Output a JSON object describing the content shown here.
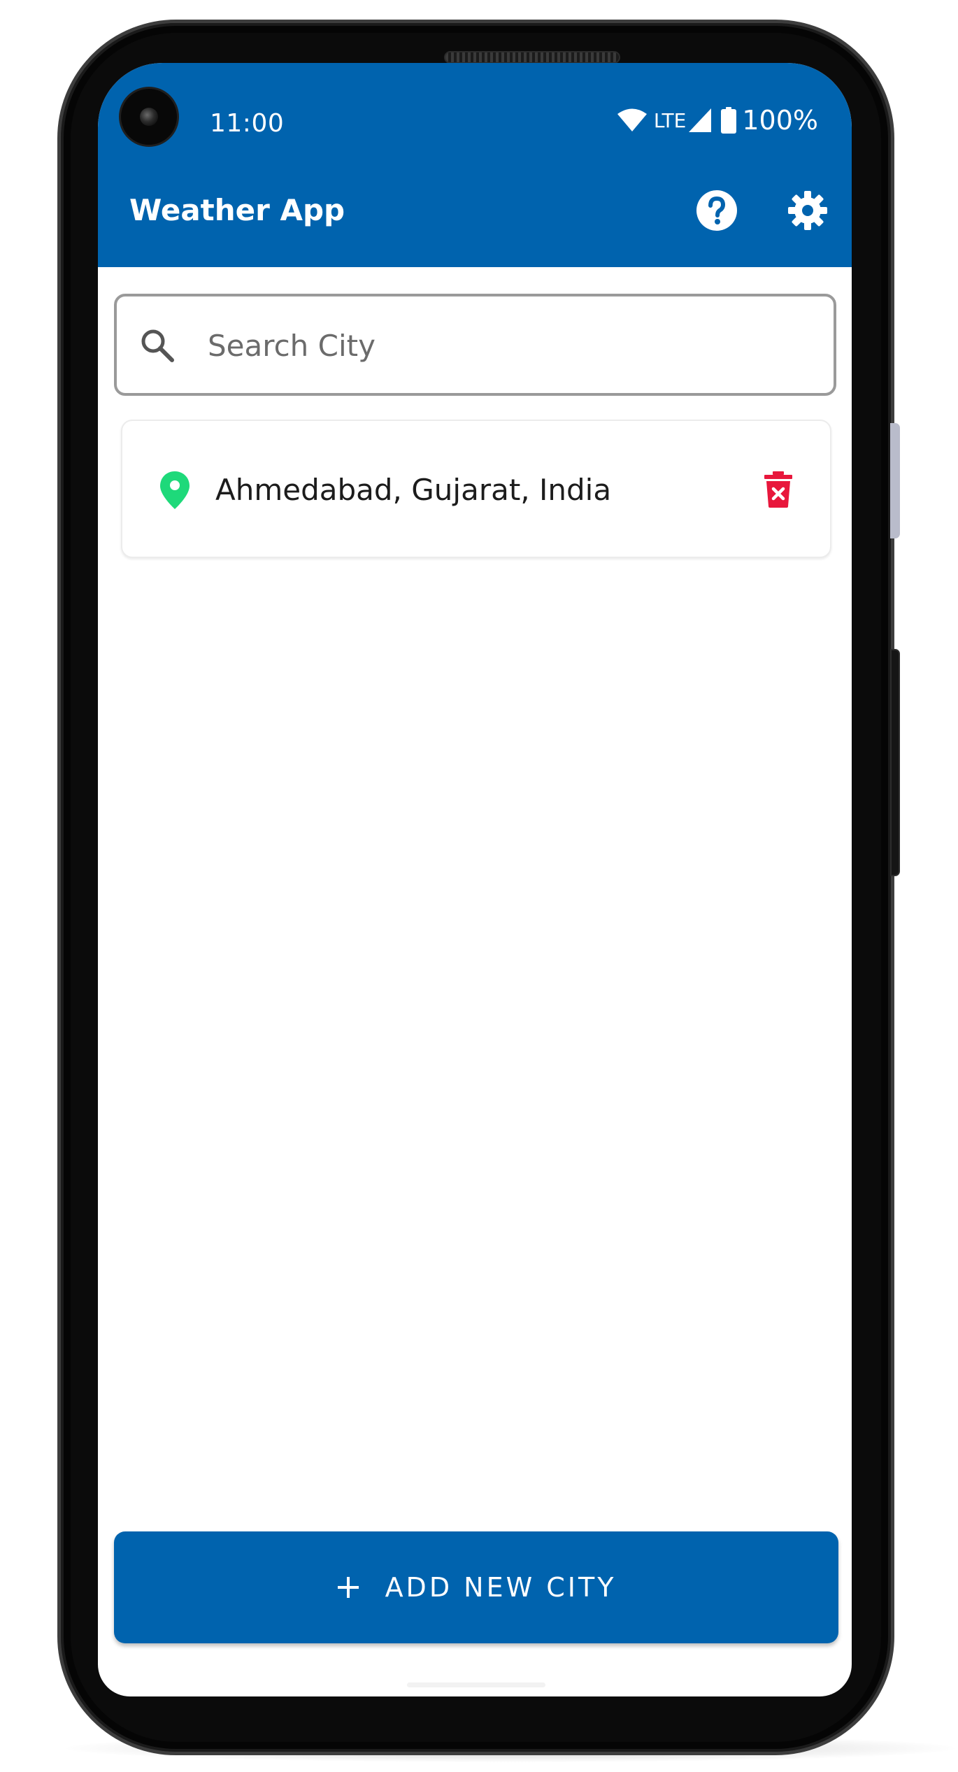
{
  "status_bar": {
    "time": "11:00",
    "network": "LTE",
    "battery": "100%"
  },
  "app_bar": {
    "title": "Weather App",
    "help_icon": "help-circle-icon",
    "settings_icon": "gear-icon",
    "background_color": "#0063ae"
  },
  "search": {
    "placeholder": "Search City",
    "value": "",
    "icon": "search-icon"
  },
  "cities": [
    {
      "name": "Ahmedabad, Gujarat, India",
      "icon": "map-pin-icon",
      "icon_color": "#1ed97a",
      "delete_icon": "trash-icon",
      "delete_color": "#e8173c"
    }
  ],
  "add_button": {
    "label": "ADD NEW CITY",
    "icon": "plus-icon",
    "background_color": "#0063ae"
  }
}
